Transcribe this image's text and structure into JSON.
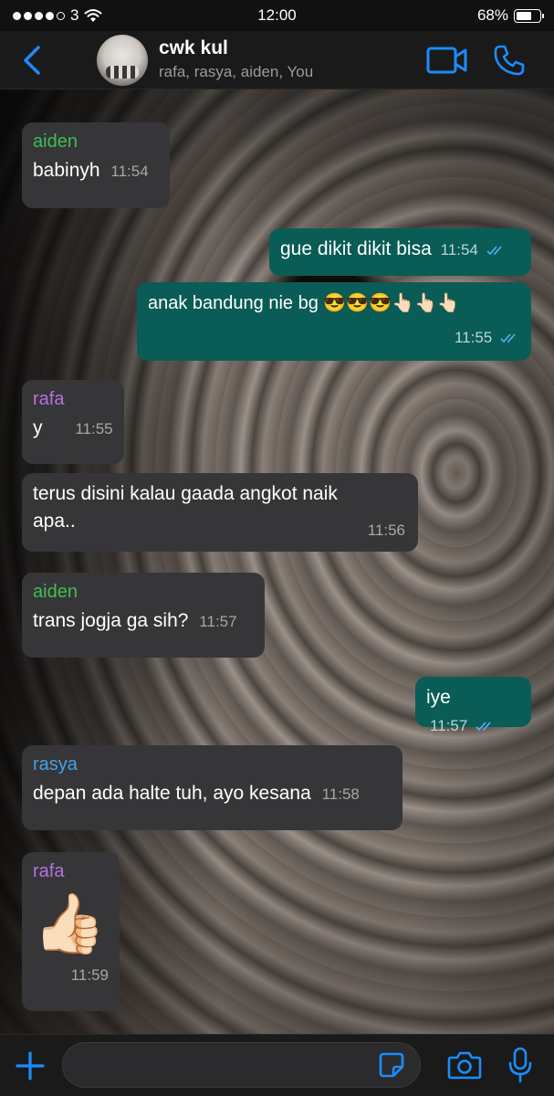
{
  "status_bar": {
    "carrier": "3",
    "time": "12:00",
    "battery_percent": "68%",
    "battery_level": 0.68,
    "signal_bars_filled": 4,
    "signal_bars_total": 5
  },
  "header": {
    "back_icon": "chevron-left-icon",
    "title": "cwk kul",
    "members": "rafa, rasya, aiden, You",
    "accent_color": "#1a8cff"
  },
  "messages": [
    {
      "direction": "in",
      "sender": "aiden",
      "text": "babinyh",
      "time": "11:54"
    },
    {
      "direction": "out",
      "text": "gue dikit dikit bisa",
      "time": "11:54",
      "status": "read"
    },
    {
      "direction": "out",
      "text": "anak bandung nie bg 😎😎😎👆🏻👆🏻👆🏻",
      "time": "11:55",
      "status": "read"
    },
    {
      "direction": "in",
      "sender": "rafa",
      "text": "y",
      "time": "11:55"
    },
    {
      "direction": "in",
      "text": "terus disini kalau gaada angkot naik apa..",
      "time": "11:56"
    },
    {
      "direction": "in",
      "sender": "aiden",
      "text": "trans jogja ga sih?",
      "time": "11:57"
    },
    {
      "direction": "out",
      "text": "iye",
      "time": "11:57",
      "status": "read"
    },
    {
      "direction": "in",
      "sender": "rasya",
      "text": "depan ada halte tuh, ayo kesana",
      "time": "11:58"
    },
    {
      "direction": "in",
      "sender": "rafa",
      "text": "👍🏻",
      "time": "11:59"
    }
  ],
  "input": {
    "placeholder": "",
    "value": ""
  },
  "colors": {
    "incoming_bubble": "#363638",
    "outgoing_bubble": "#0a5c56",
    "aiden": "#3fbe4f",
    "rafa": "#b670e0",
    "rasya": "#43a2e6"
  }
}
